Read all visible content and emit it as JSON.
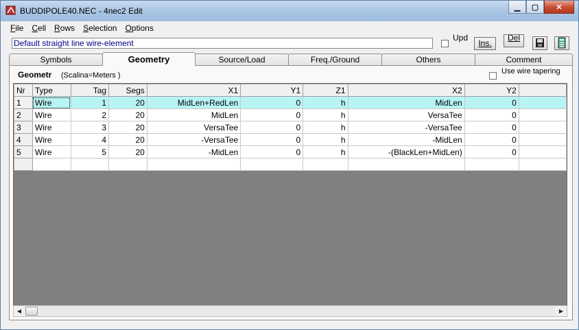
{
  "window": {
    "title": "BUDDIPOLE40.NEC - 4nec2 Edit"
  },
  "caption": {
    "minimize": "▁",
    "maximize": "▢",
    "close": "✕"
  },
  "menu": {
    "file": {
      "key": "F",
      "rest": "ile"
    },
    "cell": {
      "key": "C",
      "rest": "ell"
    },
    "rows": {
      "key": "R",
      "rest": "ows"
    },
    "selection": {
      "key": "S",
      "rest": "election"
    },
    "options": {
      "key": "O",
      "rest": "ptions"
    }
  },
  "toolbar": {
    "description": "Default straight line wire-element",
    "upd_label": "Upd",
    "ins_label": "Ins.",
    "del_label": "Del",
    "save_icon": "floppy-disk-icon",
    "calc_icon": "calculator-icon"
  },
  "tabs": {
    "symbols": "Symbols",
    "geometry": "Geometry",
    "source_load": "Source/Load",
    "freq_ground": "Freq./Ground",
    "others": "Others",
    "comment": "Comment"
  },
  "geometry": {
    "label": "Geometr",
    "scaling": "(Scalina=Meters )",
    "taper_label": "Use wire tapering"
  },
  "table": {
    "headers": {
      "nr": "Nr",
      "type": "Type",
      "tag": "Tag",
      "segs": "Segs",
      "x1": "X1",
      "y1": "Y1",
      "z1": "Z1",
      "x2": "X2",
      "y2": "Y2"
    },
    "rows": [
      {
        "nr": "1",
        "type": "Wire",
        "tag": "1",
        "segs": "20",
        "x1": "MidLen+RedLen",
        "y1": "0",
        "z1": "h",
        "x2": "MidLen",
        "y2": "0"
      },
      {
        "nr": "2",
        "type": "Wire",
        "tag": "2",
        "segs": "20",
        "x1": "MidLen",
        "y1": "0",
        "z1": "h",
        "x2": "VersaTee",
        "y2": "0"
      },
      {
        "nr": "3",
        "type": "Wire",
        "tag": "3",
        "segs": "20",
        "x1": "VersaTee",
        "y1": "0",
        "z1": "h",
        "x2": "-VersaTee",
        "y2": "0"
      },
      {
        "nr": "4",
        "type": "Wire",
        "tag": "4",
        "segs": "20",
        "x1": "-VersaTee",
        "y1": "0",
        "z1": "h",
        "x2": "-MidLen",
        "y2": "0"
      },
      {
        "nr": "5",
        "type": "Wire",
        "tag": "5",
        "segs": "20",
        "x1": "-MidLen",
        "y1": "0",
        "z1": "h",
        "x2": "-(BlackLen+MidLen)",
        "y2": "0"
      }
    ]
  },
  "colors": {
    "selected_row": "#b8f4f4",
    "description_text": "#00008b",
    "grid_background": "#808080"
  }
}
